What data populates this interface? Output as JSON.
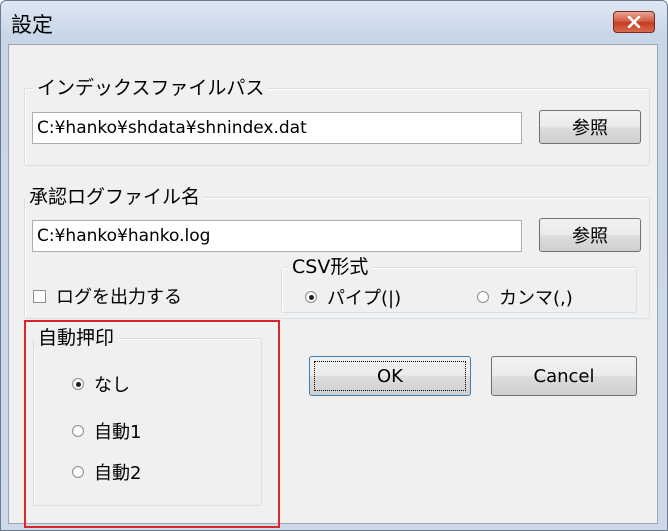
{
  "window": {
    "title": "設定",
    "close_icon": "close-x-icon"
  },
  "index_group": {
    "label": "インデックスファイルパス",
    "path_value": "C:¥hanko¥shdata¥shnindex.dat",
    "browse_label": "参照"
  },
  "log_group": {
    "label": "承認ログファイル名",
    "path_value": "C:¥hanko¥hanko.log",
    "browse_label": "参照",
    "output_log_label": "ログを出力する",
    "output_log_checked": false
  },
  "csv_group": {
    "label": "CSV形式",
    "options": [
      {
        "label": "パイプ(|)",
        "selected": true
      },
      {
        "label": "カンマ(,)",
        "selected": false
      }
    ]
  },
  "auto_stamp_group": {
    "label": "自動押印",
    "options": [
      {
        "label": "なし",
        "selected": true
      },
      {
        "label": "自動1",
        "selected": false
      },
      {
        "label": "自動2",
        "selected": false
      }
    ]
  },
  "buttons": {
    "ok_label": "OK",
    "cancel_label": "Cancel"
  },
  "colors": {
    "highlight_border": "#d9262b",
    "close_button": "#c63b20"
  }
}
